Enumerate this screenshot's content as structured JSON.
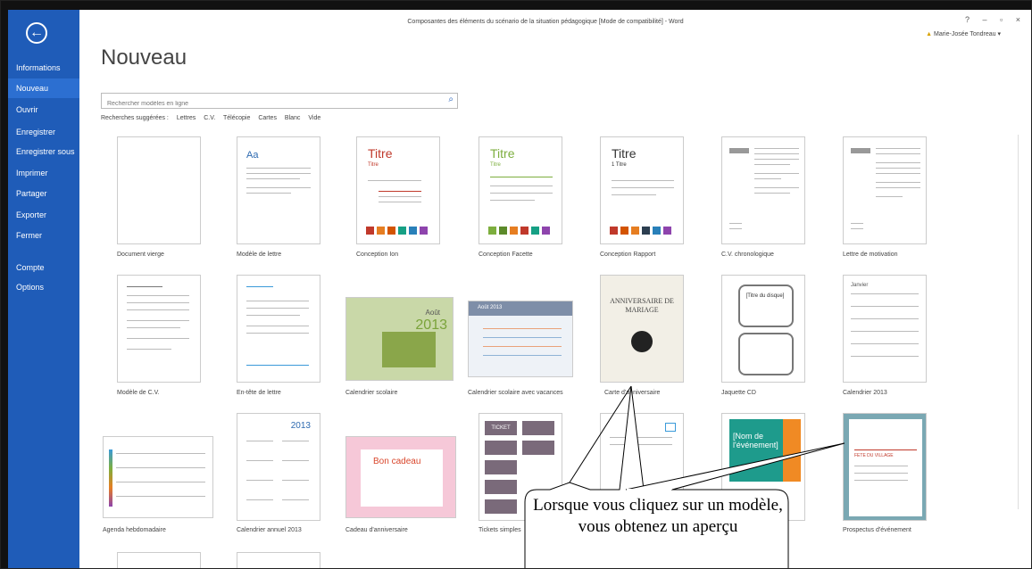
{
  "window": {
    "title": "Composantes des éléments du scénario de la situation pédagogique [Mode de compatibilité] - Word",
    "user": "Marie-Josée Tondreau"
  },
  "sidebar": {
    "items": [
      {
        "label": "Informations"
      },
      {
        "label": "Nouveau"
      },
      {
        "label": "Ouvrir"
      },
      {
        "label": "Enregistrer"
      },
      {
        "label": "Enregistrer sous"
      },
      {
        "label": "Imprimer"
      },
      {
        "label": "Partager"
      },
      {
        "label": "Exporter"
      },
      {
        "label": "Fermer"
      },
      {
        "label": "Compte"
      },
      {
        "label": "Options"
      }
    ]
  },
  "main": {
    "heading": "Nouveau",
    "search_placeholder": "Rechercher modèles en ligne",
    "suggestions_label": "Recherches suggérées :",
    "suggestions": [
      "Lettres",
      "C.V.",
      "Télécopie",
      "Cartes",
      "Blanc",
      "Vide"
    ]
  },
  "templates": [
    {
      "label": "Document vierge"
    },
    {
      "label": "Modèle de lettre",
      "thumb": "Aa"
    },
    {
      "label": "Conception Ion",
      "thumb": "Titre",
      "sub": "Titre"
    },
    {
      "label": "Conception Facette",
      "thumb": "Titre",
      "sub": "Titre"
    },
    {
      "label": "Conception Rapport",
      "thumb": "Titre",
      "sub": "1  Titre"
    },
    {
      "label": "C.V. chronologique"
    },
    {
      "label": "Lettre de motivation"
    },
    {
      "label": "Modèle de C.V."
    },
    {
      "label": "En-tête de lettre"
    },
    {
      "label": "Calendrier scolaire",
      "thumb": "Août",
      "sub": "2013"
    },
    {
      "label": "Calendrier scolaire avec vacances",
      "thumb": "Août 2013"
    },
    {
      "label": "Carte d'anniversaire",
      "thumb": "ANNIVERSAIRE DE MARIAGE"
    },
    {
      "label": "Jaquette CD",
      "thumb": "[Titre du disque]"
    },
    {
      "label": "Calendrier 2013",
      "thumb": "Janvier"
    },
    {
      "label": "Agenda hebdomadaire"
    },
    {
      "label": "Calendrier annuel 2013",
      "thumb": "2013"
    },
    {
      "label": "Cadeau d'anniversaire",
      "thumb": "Bon cadeau"
    },
    {
      "label": "Tickets simples",
      "thumb": "TICKET"
    },
    {
      "label": "Prospectus d'événement",
      "thumb": "FETE DU VILLAGE",
      "sub": "[Nom de l'événement]"
    }
  ],
  "callout": {
    "text": "Lorsque vous cliquez sur un modèle, vous obtenez un aperçu"
  },
  "colors": {
    "accent": "#1f5cb8",
    "ion_red": "#c0392b",
    "facette_green": "#7dae3e"
  }
}
